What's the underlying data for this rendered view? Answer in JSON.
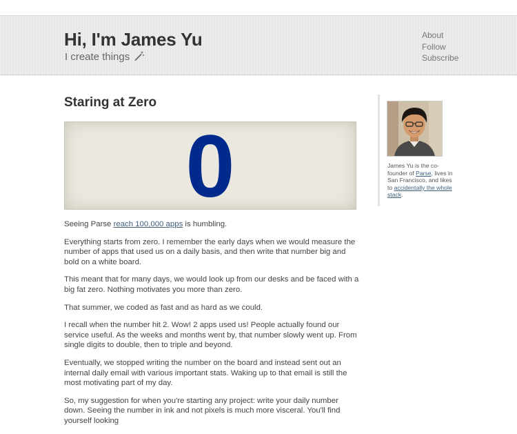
{
  "header": {
    "title": "Hi, I'm James Yu",
    "tagline": "I create things",
    "tagline_icon": "magic-wand-icon",
    "nav": [
      "About",
      "Follow",
      "Subscribe"
    ]
  },
  "post": {
    "title": "Staring at Zero",
    "counter": "0",
    "counter_color": "#002a8c",
    "p1": {
      "before": "Seeing Parse ",
      "link": "reach 100,000 apps",
      "after": " is humbling."
    },
    "p2": "Everything starts from zero. I remember the early days when we would measure the number of apps that used us on a daily basis, and then write that number big and bold on a white board.",
    "p3": "This meant that for many days, we would look up from our desks and be faced with a big fat zero. Nothing motivates you more than zero.",
    "p4": "That summer, we coded as fast and as hard as we could.",
    "p5": "I recall when the number hit 2. Wow! 2 apps used us! People actually found our service useful. As the weeks and months went by, that number slowly went up. From single digits to double, then to triple and beyond.",
    "p6": "Eventually, we stopped writing the number on the board and instead sent out an internal daily email with various important stats. Waking up to that email is still the most motivating part of my day.",
    "p7": "So, my suggestion for when you're starting any project: write your daily number down. Seeing the number in ink and not pixels is much more visceral. You'll find yourself looking"
  },
  "sidebar": {
    "bio_1": "James Yu is the co-founder of ",
    "bio_link_1": "Parse",
    "bio_2": ", lives in San Francisco, and likes to ",
    "bio_link_2": "accidentally the whole stack",
    "bio_3": "."
  },
  "colors": {
    "link": "#3e5f7f",
    "header_bg": "#e9e9e9",
    "counter_bg": "#ebe9df"
  }
}
